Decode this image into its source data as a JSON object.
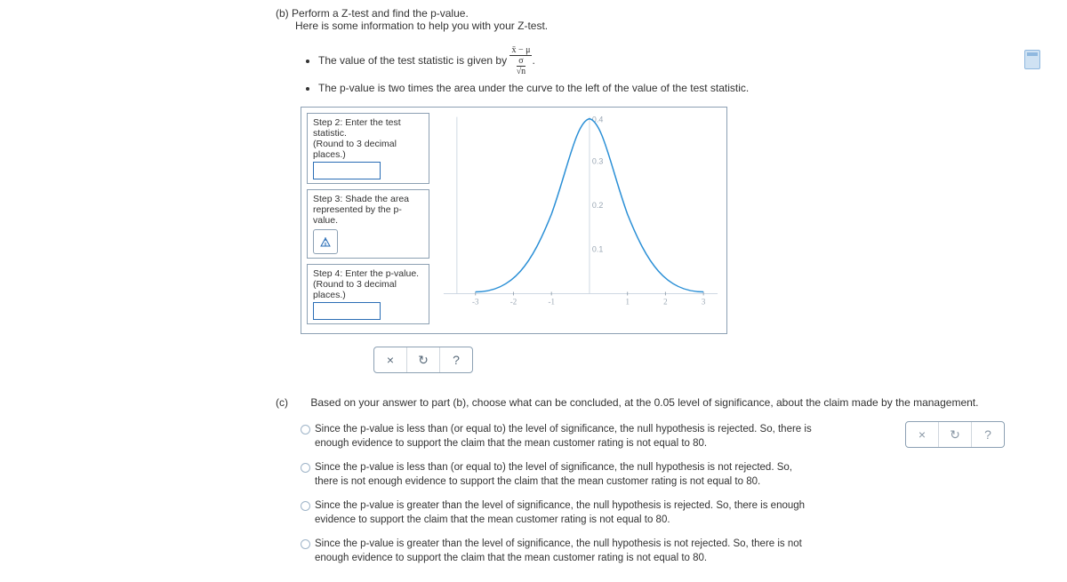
{
  "partB": {
    "label": "(b)",
    "title_line1": "Perform a Z-test and find the p-value.",
    "title_line2": "Here is some information to help you with your Z-test.",
    "bullet1_pre": "The value of the test statistic is given by ",
    "formula_num": "x̄ − μ",
    "formula_den_sigma": "σ",
    "formula_den_sqrtn": "√n",
    "bullet2": "The p-value is two times the area under the curve to the left of the value of the test statistic.",
    "step2_line1": "Step 2: Enter the test statistic.",
    "step2_line2": "(Round to 3 decimal places.)",
    "step3_line1": "Step 3: Shade the area represented by the p-value.",
    "step4_line1": "Step 4: Enter the p-value.",
    "step4_line2": "(Round to 3 decimal places.)"
  },
  "chart_data": {
    "type": "line",
    "title": "",
    "xlabel": "",
    "ylabel": "",
    "xlim": [
      -3.5,
      3.5
    ],
    "ylim": [
      0,
      0.4
    ],
    "x_ticks": [
      -3,
      -2,
      -1,
      1,
      2,
      3
    ],
    "y_ticks": [
      0.1,
      0.2,
      0.3,
      0.4
    ],
    "series": [
      {
        "name": "normal-pdf",
        "x": [
          -3,
          -2.5,
          -2,
          -1.5,
          -1,
          -0.5,
          0,
          0.5,
          1,
          1.5,
          2,
          2.5,
          3
        ],
        "y": [
          0.004,
          0.018,
          0.054,
          0.13,
          0.242,
          0.352,
          0.399,
          0.352,
          0.242,
          0.13,
          0.054,
          0.018,
          0.004
        ]
      }
    ]
  },
  "toolbar": {
    "close": "×",
    "reset": "↻",
    "help": "?"
  },
  "partC": {
    "label": "(c)",
    "intro": "Based on your answer to part (b), choose what can be concluded, at the 0.05 level of significance, about the claim made by the management.",
    "opt1": "Since the p-value is less than (or equal to) the level of significance, the null hypothesis is rejected. So, there is enough evidence to support the claim that the mean customer rating is not equal to 80.",
    "opt2": "Since the p-value is less than (or equal to) the level of significance, the null hypothesis is not rejected. So, there is not enough evidence to support the claim that the mean customer rating is not equal to 80.",
    "opt3": "Since the p-value is greater than the level of significance, the null hypothesis is rejected. So, there is enough evidence to support the claim that the mean customer rating is not equal to 80.",
    "opt4": "Since the p-value is greater than the level of significance, the null hypothesis is not rejected. So, there is not enough evidence to support the claim that the mean customer rating is not equal to 80."
  }
}
